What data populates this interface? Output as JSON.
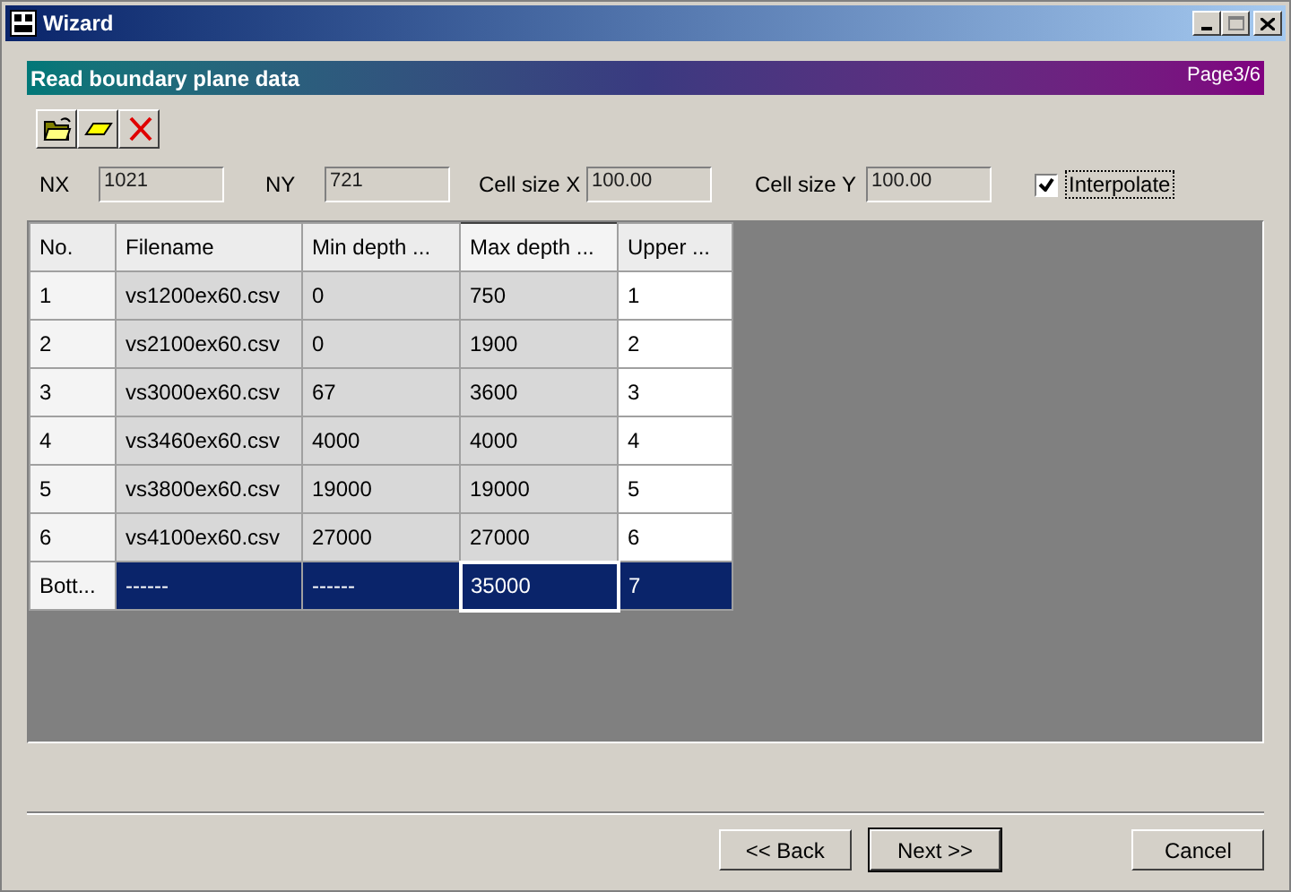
{
  "window": {
    "title": "Wizard"
  },
  "header": {
    "title": "Read boundary plane data",
    "page": "Page3/6"
  },
  "toolbar": [
    {
      "kind": "open"
    },
    {
      "kind": "shape"
    },
    {
      "kind": "delete"
    }
  ],
  "fields": [
    {
      "label": "NX",
      "value": "1021"
    },
    {
      "label": "NY",
      "value": "721"
    },
    {
      "label": "Cell size X",
      "value": "100.00"
    },
    {
      "label": "Cell size Y",
      "value": "100.00"
    }
  ],
  "interpolate": {
    "label": "Interpolate",
    "checked": true
  },
  "table": {
    "columns": [
      {
        "label": "No.",
        "readonly": false,
        "current": false
      },
      {
        "label": "Filename",
        "readonly": true,
        "current": false
      },
      {
        "label": "Min depth ...",
        "readonly": true,
        "current": false
      },
      {
        "label": "Max depth ...",
        "readonly": true,
        "current": true
      },
      {
        "label": "Upper ...",
        "readonly": false,
        "current": false
      }
    ],
    "rows": [
      {
        "selected": false,
        "cells": [
          "1",
          "vs1200ex60.csv",
          "0",
          "750",
          "1"
        ]
      },
      {
        "selected": false,
        "cells": [
          "2",
          "vs2100ex60.csv",
          "0",
          "1900",
          "2"
        ]
      },
      {
        "selected": false,
        "cells": [
          "3",
          "vs3000ex60.csv",
          "67",
          "3600",
          "3"
        ]
      },
      {
        "selected": false,
        "cells": [
          "4",
          "vs3460ex60.csv",
          "4000",
          "4000",
          "4"
        ]
      },
      {
        "selected": false,
        "cells": [
          "5",
          "vs3800ex60.csv",
          "19000",
          "19000",
          "5"
        ]
      },
      {
        "selected": false,
        "cells": [
          "6",
          "vs4100ex60.csv",
          "27000",
          "27000",
          "6"
        ]
      },
      {
        "selected": true,
        "cells": [
          "Bott...",
          "------",
          "------",
          "35000",
          "7"
        ]
      }
    ]
  },
  "buttons": [
    {
      "label": "<< Back",
      "default": false
    },
    {
      "label": "Next >>",
      "default": true
    },
    {
      "label": "Cancel",
      "default": false
    }
  ]
}
